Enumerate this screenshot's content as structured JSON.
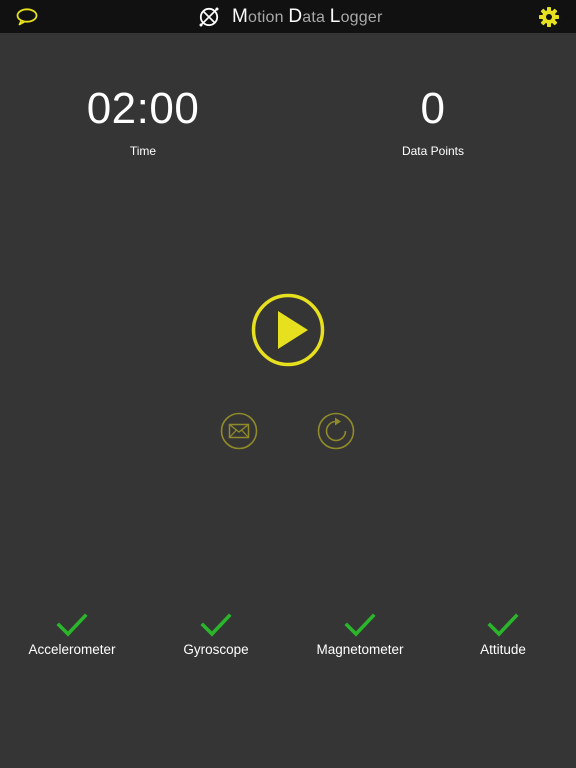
{
  "header": {
    "title_parts": [
      {
        "cap": "M",
        "rest": "otion "
      },
      {
        "cap": "D",
        "rest": "ata "
      },
      {
        "cap": "L",
        "rest": "ogger"
      }
    ],
    "icons": {
      "left": "chat-bubble-icon",
      "logo": "compass-logo-icon",
      "right": "gear-icon"
    }
  },
  "stats": {
    "time": {
      "value": "02:00",
      "label": "Time"
    },
    "data_points": {
      "value": "0",
      "label": "Data Points"
    }
  },
  "controls": {
    "play": "play-icon",
    "mail": "mail-icon",
    "reset": "reset-icon"
  },
  "sensors": [
    {
      "label": "Accelerometer",
      "enabled": true
    },
    {
      "label": "Gyroscope",
      "enabled": true
    },
    {
      "label": "Magnetometer",
      "enabled": true
    },
    {
      "label": "Attitude",
      "enabled": true
    }
  ],
  "colors": {
    "background": "#353535",
    "topbar": "#111111",
    "accent_yellow": "#e6e01f",
    "muted_yellow": "#8f8a2a",
    "check_green": "#2bb52b",
    "title_dim": "#a9a9a9"
  }
}
